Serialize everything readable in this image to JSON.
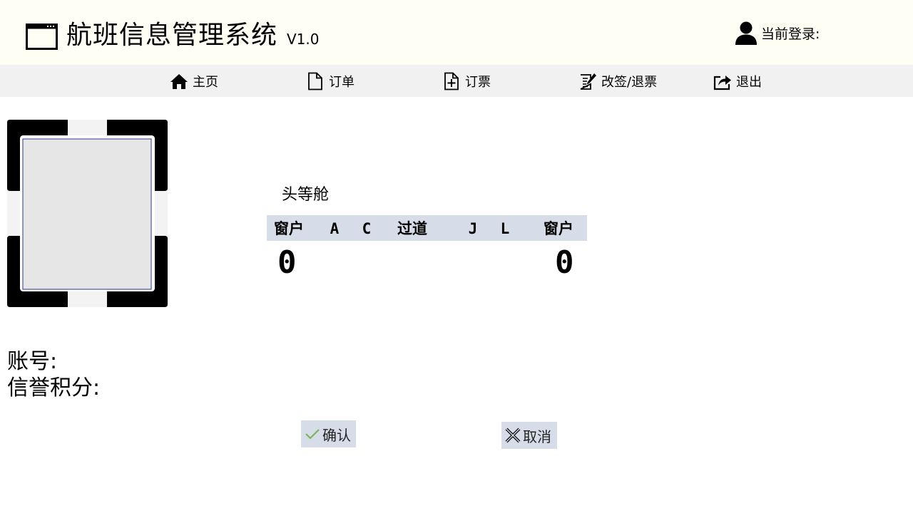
{
  "header": {
    "title": "航班信息管理系统",
    "version": "V1.0",
    "login_label": "当前登录:"
  },
  "nav": {
    "home": "主页",
    "orders": "订单",
    "book": "订票",
    "change_refund": "改签/退票",
    "logout": "退出"
  },
  "cabin": {
    "title": "头等舱",
    "columns": [
      "窗户",
      "A",
      "C",
      "过道",
      "J",
      "L",
      "窗户"
    ],
    "row_left": "0",
    "row_right": "0"
  },
  "account": {
    "account_label": "账号:",
    "credit_label": "信誉积分:"
  },
  "buttons": {
    "confirm": "确认",
    "cancel": "取消"
  }
}
